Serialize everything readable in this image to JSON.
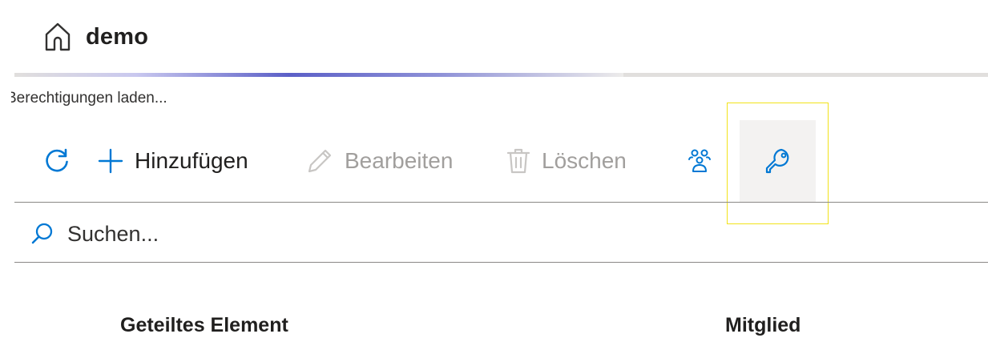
{
  "header": {
    "title": "demo",
    "home_icon": "home-icon"
  },
  "progress": {
    "indeterminate": true,
    "accent_color": "#5b5fc7"
  },
  "status": {
    "loading_text": "Berechtigungen laden..."
  },
  "toolbar": {
    "refresh_icon": "refresh-icon",
    "add_label": "Hinzufügen",
    "edit_label": "Bearbeiten",
    "delete_label": "Löschen",
    "members_icon": "people-group-icon",
    "permissions_icon": "key-icon",
    "enabled_color": "#0078d4",
    "disabled_color": "#a19f9d"
  },
  "search": {
    "placeholder": "Suchen..."
  },
  "table": {
    "columns": [
      "Geteiltes Element",
      "Mitglied"
    ]
  }
}
